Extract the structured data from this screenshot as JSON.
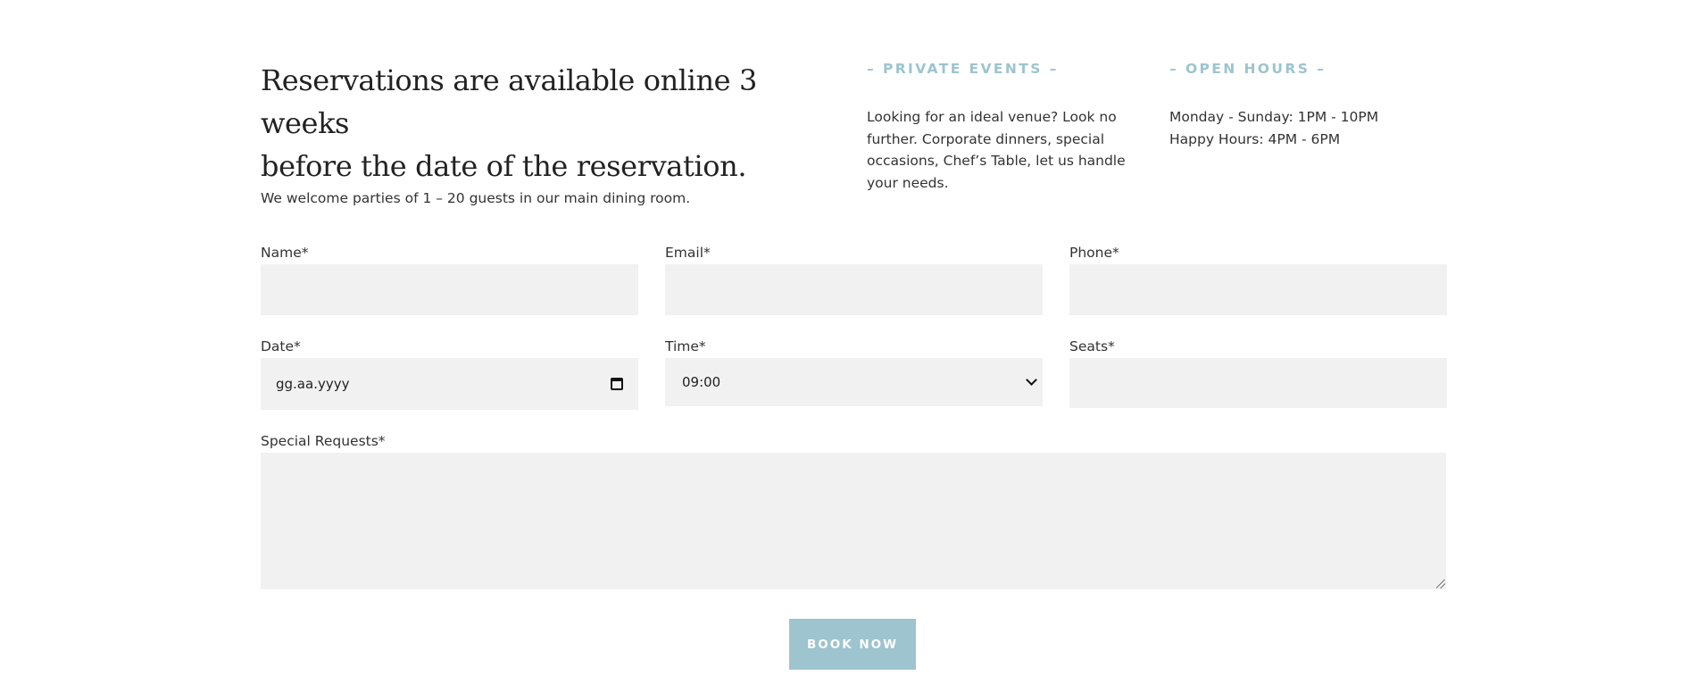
{
  "intro": {
    "headline_line1": "Reservations are available online 3 weeks",
    "headline_line2": "before the date of the reservation.",
    "subline": "We welcome parties of 1 – 20 guests in our main dining room."
  },
  "private_events": {
    "heading": "– PRIVATE EVENTS –",
    "text": "Looking for an ideal venue? Look no further. Corporate dinners, special occasions, Chef’s Table, let us handle your needs."
  },
  "open_hours": {
    "heading": "– OPEN HOURS –",
    "line1": "Monday - Sunday: 1PM - 10PM",
    "line2": "Happy Hours: 4PM - 6PM"
  },
  "form": {
    "name_label": "Name*",
    "email_label": "Email*",
    "phone_label": "Phone*",
    "date_label": "Date*",
    "date_placeholder": "gg.aa.yyyy",
    "time_label": "Time*",
    "time_value": "09:00",
    "seats_label": "Seats*",
    "requests_label": "Special Requests*",
    "submit_label": "BOOK NOW"
  },
  "colors": {
    "accent": "#9dc4cf",
    "field_bg": "#f1f1f1",
    "text": "#333333"
  },
  "icons": {
    "date": "calendar-icon",
    "time": "chevron-down-icon"
  }
}
